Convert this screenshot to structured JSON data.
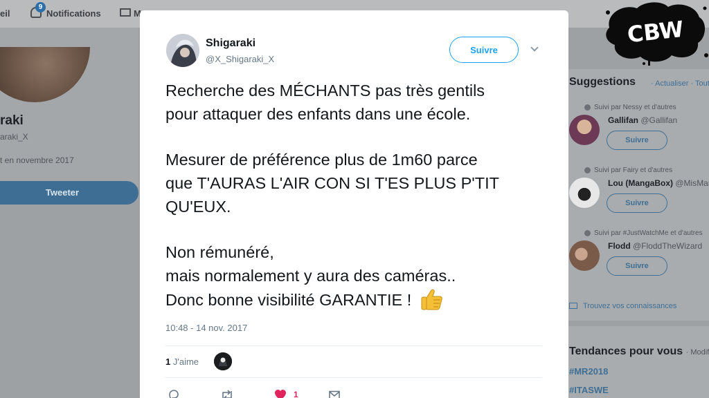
{
  "nav": {
    "home_partial": "eil",
    "notifications_badge": "9",
    "notifications_label": "Notifications",
    "messages_partial": "M"
  },
  "profile": {
    "name_partial": "raki",
    "handle_partial": "araki_X",
    "joined_partial": "t en novembre 2017",
    "tweet_button": "Tweeter"
  },
  "tweet": {
    "author_name": "Shigaraki",
    "author_handle": "@X_Shigaraki_X",
    "follow_label": "Suivre",
    "paragraphs": [
      [
        "Recherche des MÉCHANTS pas très gentils",
        "pour attaquer des enfants dans une école."
      ],
      [
        "Mesurer de préférence plus de 1m60 parce",
        "que T'AURAS L'AIR CON SI T'ES PLUS P'TIT",
        "QU'EUX."
      ],
      [
        "Non rémunéré,",
        "mais normalement y aura des caméras..",
        "Donc bonne visibilité GARANTIE !"
      ]
    ],
    "timestamp": "10:48 - 14 nov. 2017",
    "likes_count": "1",
    "likes_label": "J'aime",
    "heart_count": "1",
    "icons": {
      "thumb": "thumbs-up-emoji",
      "reply": "reply-icon",
      "retweet": "retweet-icon",
      "like": "heart-icon",
      "dm": "dm-icon"
    }
  },
  "sidebar": {
    "suggestions_title": "Suggestions",
    "suggestions_actions": "· Actualiser · Tout afficher",
    "items": [
      {
        "social": "Suivi par Nessy et d'autres",
        "name": "Gallifan",
        "handle": "@Gallifan",
        "follow": "Suivre"
      },
      {
        "social": "Suivi par Fairy et d'autres",
        "name": "Lou (MangaBox)",
        "handle": "@MisMangaBox",
        "follow": "Suivre"
      },
      {
        "social": "Suivi par #JustWatchMe et d'autres",
        "name": "Flodd",
        "handle": "@FloddTheWizard",
        "follow": "Suivre"
      }
    ],
    "find_friends": "Trouvez vos connaissances",
    "trends_title": "Tendances pour vous",
    "trends_mod": "· Modifier",
    "trends": [
      "#MR2018",
      "#ITASWE"
    ]
  },
  "watermark": {
    "text": "CBW"
  },
  "colors": {
    "accent": "#1da1f2",
    "heart": "#e0245e",
    "text": "#14171a",
    "muted": "#657786"
  }
}
